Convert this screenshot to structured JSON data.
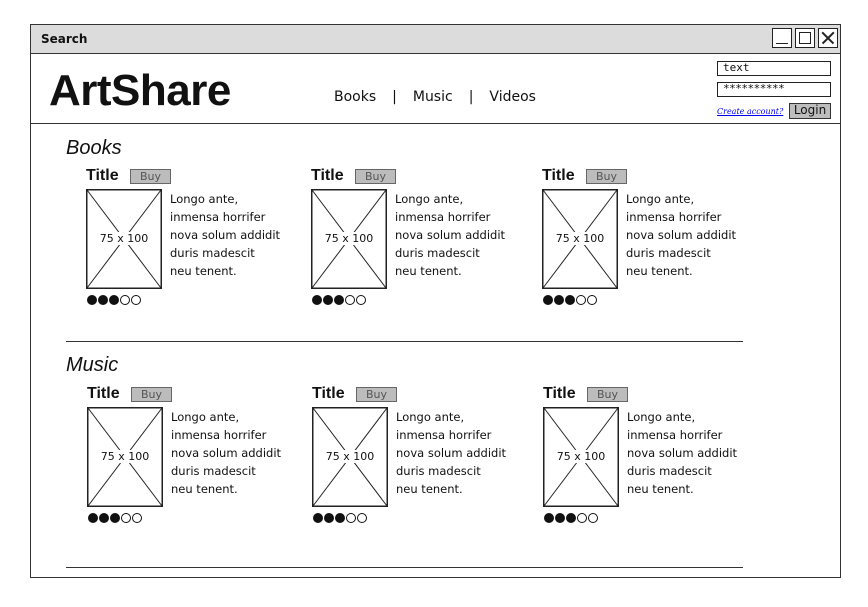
{
  "window": {
    "title": "Search"
  },
  "header": {
    "logo": "ArtShare",
    "nav": [
      "Books",
      "Music",
      "Videos"
    ],
    "nav_separator": "|"
  },
  "login": {
    "username_value": "text",
    "password_value": "**********",
    "create_account": "Create account?",
    "login_label": "Login"
  },
  "sections": [
    {
      "title": "Books",
      "items": [
        {
          "title": "Title",
          "buy": "Buy",
          "thumb": "75 x 100",
          "desc": [
            "Longo ante,",
            "inmensa horrifer",
            "nova solum addidit",
            "duris madescit",
            "neu tenent."
          ],
          "rating": 3,
          "rating_max": 5
        },
        {
          "title": "Title",
          "buy": "Buy",
          "thumb": "75 x 100",
          "desc": [
            "Longo ante,",
            "inmensa horrifer",
            "nova solum addidit",
            "duris madescit",
            "neu tenent."
          ],
          "rating": 3,
          "rating_max": 5
        },
        {
          "title": "Title",
          "buy": "Buy",
          "thumb": "75 x 100",
          "desc": [
            "Longo ante,",
            "inmensa horrifer",
            "nova solum addidit",
            "duris madescit",
            "neu tenent."
          ],
          "rating": 3,
          "rating_max": 5
        }
      ]
    },
    {
      "title": "Music",
      "items": [
        {
          "title": "Title",
          "buy": "Buy",
          "thumb": "75 x 100",
          "desc": [
            "Longo ante,",
            "inmensa horrifer",
            "nova solum addidit",
            "duris madescit",
            "neu tenent."
          ],
          "rating": 3,
          "rating_max": 5
        },
        {
          "title": "Title",
          "buy": "Buy",
          "thumb": "75 x 100",
          "desc": [
            "Longo ante,",
            "inmensa horrifer",
            "nova solum addidit",
            "duris madescit",
            "neu tenent."
          ],
          "rating": 3,
          "rating_max": 5
        },
        {
          "title": "Title",
          "buy": "Buy",
          "thumb": "75 x 100",
          "desc": [
            "Longo ante,",
            "inmensa horrifer",
            "nova solum addidit",
            "duris madescit",
            "neu tenent."
          ],
          "rating": 3,
          "rating_max": 5
        }
      ]
    }
  ]
}
